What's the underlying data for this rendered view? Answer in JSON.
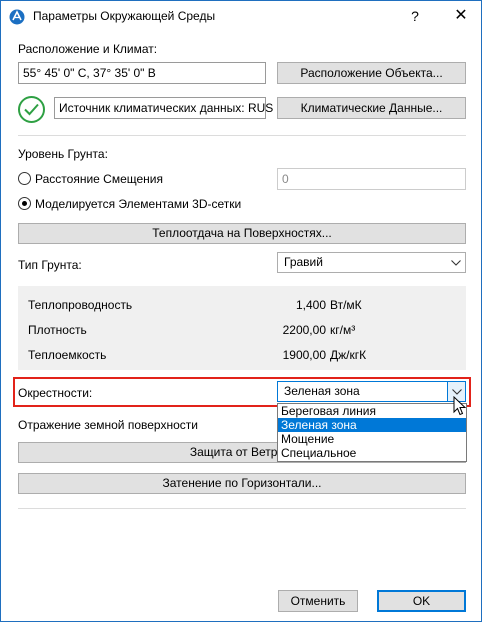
{
  "window": {
    "title": "Параметры Окружающей Среды",
    "help_label": "?",
    "close_label": "✕"
  },
  "location": {
    "section_label": "Расположение и Климат:",
    "coordinates_value": "55° 45' 0\" С, 37° 35' 0\" В",
    "project_location_button": "Расположение Объекта...",
    "climate_source_text": "Источник климатических данных: RUS",
    "climate_data_button": "Климатические Данные..."
  },
  "ground_level": {
    "section_label": "Уровень Грунта:",
    "offset_option_label": "Расстояние Смещения",
    "offset_value": "0",
    "mesh_option_label": "Моделируется Элементами 3D-сетки",
    "offset_selected": false,
    "mesh_selected": true,
    "heat_transfer_button": "Теплоотдача на Поверхностях..."
  },
  "soil_type": {
    "label": "Тип Грунта:",
    "selected_value": "Гравий"
  },
  "soil_properties": [
    {
      "name": "Теплопроводность",
      "value": "1,400",
      "unit": "Вт/мК"
    },
    {
      "name": "Плотность",
      "value": "2200,00",
      "unit": "кг/м³"
    },
    {
      "name": "Теплоемкость",
      "value": "1900,00",
      "unit": "Дж/кгК"
    }
  ],
  "surroundings": {
    "label": "Окрестности:",
    "selected_value": "Зеленая зона",
    "options": [
      "Береговая линия",
      "Зеленая зона",
      "Мощение",
      "Специальное"
    ],
    "selected_index": 1
  },
  "ground_reflection_label": "Отражение земной поверхности",
  "wind_protection_button": "Защита от Ветра...",
  "horizon_shading_button": "Затенение по Горизонтали...",
  "footer": {
    "cancel_button": "Отменить",
    "ok_button": "OK"
  },
  "colors": {
    "window_border": "#1f6fbf",
    "highlight": "#e2231a",
    "selection": "#0078d7",
    "check_green": "#2ea043",
    "button_face": "#e1e1e1"
  }
}
